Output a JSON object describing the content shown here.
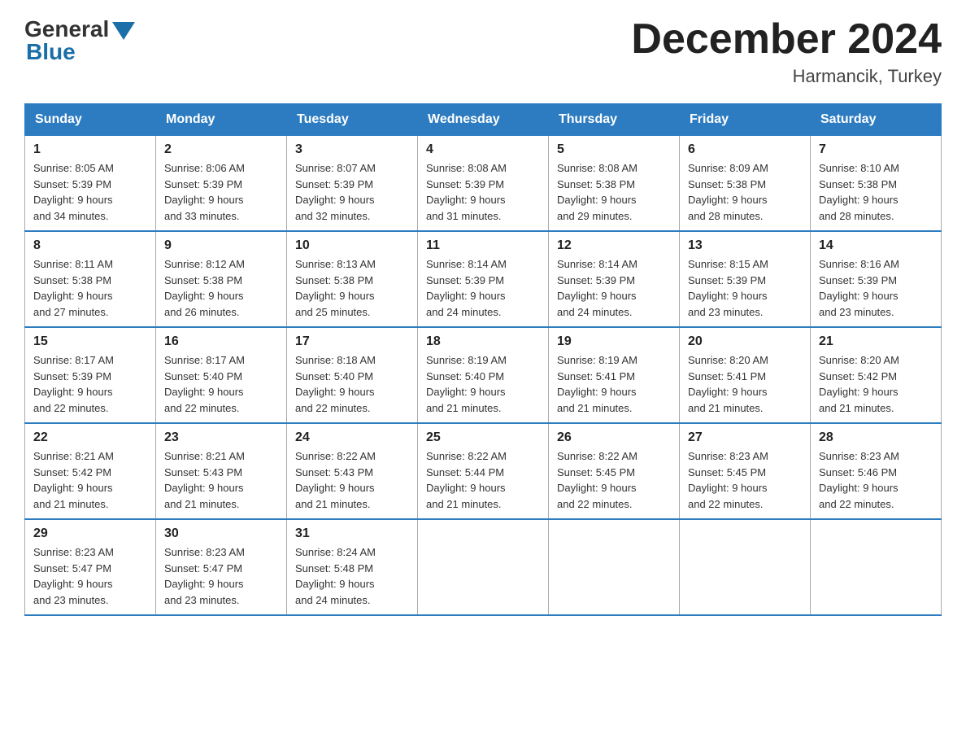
{
  "logo": {
    "general": "General",
    "blue": "Blue"
  },
  "title": "December 2024",
  "location": "Harmancik, Turkey",
  "days_of_week": [
    "Sunday",
    "Monday",
    "Tuesday",
    "Wednesday",
    "Thursday",
    "Friday",
    "Saturday"
  ],
  "weeks": [
    [
      {
        "day": "1",
        "sunrise": "8:05 AM",
        "sunset": "5:39 PM",
        "daylight": "9 hours and 34 minutes."
      },
      {
        "day": "2",
        "sunrise": "8:06 AM",
        "sunset": "5:39 PM",
        "daylight": "9 hours and 33 minutes."
      },
      {
        "day": "3",
        "sunrise": "8:07 AM",
        "sunset": "5:39 PM",
        "daylight": "9 hours and 32 minutes."
      },
      {
        "day": "4",
        "sunrise": "8:08 AM",
        "sunset": "5:39 PM",
        "daylight": "9 hours and 31 minutes."
      },
      {
        "day": "5",
        "sunrise": "8:08 AM",
        "sunset": "5:38 PM",
        "daylight": "9 hours and 29 minutes."
      },
      {
        "day": "6",
        "sunrise": "8:09 AM",
        "sunset": "5:38 PM",
        "daylight": "9 hours and 28 minutes."
      },
      {
        "day": "7",
        "sunrise": "8:10 AM",
        "sunset": "5:38 PM",
        "daylight": "9 hours and 28 minutes."
      }
    ],
    [
      {
        "day": "8",
        "sunrise": "8:11 AM",
        "sunset": "5:38 PM",
        "daylight": "9 hours and 27 minutes."
      },
      {
        "day": "9",
        "sunrise": "8:12 AM",
        "sunset": "5:38 PM",
        "daylight": "9 hours and 26 minutes."
      },
      {
        "day": "10",
        "sunrise": "8:13 AM",
        "sunset": "5:38 PM",
        "daylight": "9 hours and 25 minutes."
      },
      {
        "day": "11",
        "sunrise": "8:14 AM",
        "sunset": "5:39 PM",
        "daylight": "9 hours and 24 minutes."
      },
      {
        "day": "12",
        "sunrise": "8:14 AM",
        "sunset": "5:39 PM",
        "daylight": "9 hours and 24 minutes."
      },
      {
        "day": "13",
        "sunrise": "8:15 AM",
        "sunset": "5:39 PM",
        "daylight": "9 hours and 23 minutes."
      },
      {
        "day": "14",
        "sunrise": "8:16 AM",
        "sunset": "5:39 PM",
        "daylight": "9 hours and 23 minutes."
      }
    ],
    [
      {
        "day": "15",
        "sunrise": "8:17 AM",
        "sunset": "5:39 PM",
        "daylight": "9 hours and 22 minutes."
      },
      {
        "day": "16",
        "sunrise": "8:17 AM",
        "sunset": "5:40 PM",
        "daylight": "9 hours and 22 minutes."
      },
      {
        "day": "17",
        "sunrise": "8:18 AM",
        "sunset": "5:40 PM",
        "daylight": "9 hours and 22 minutes."
      },
      {
        "day": "18",
        "sunrise": "8:19 AM",
        "sunset": "5:40 PM",
        "daylight": "9 hours and 21 minutes."
      },
      {
        "day": "19",
        "sunrise": "8:19 AM",
        "sunset": "5:41 PM",
        "daylight": "9 hours and 21 minutes."
      },
      {
        "day": "20",
        "sunrise": "8:20 AM",
        "sunset": "5:41 PM",
        "daylight": "9 hours and 21 minutes."
      },
      {
        "day": "21",
        "sunrise": "8:20 AM",
        "sunset": "5:42 PM",
        "daylight": "9 hours and 21 minutes."
      }
    ],
    [
      {
        "day": "22",
        "sunrise": "8:21 AM",
        "sunset": "5:42 PM",
        "daylight": "9 hours and 21 minutes."
      },
      {
        "day": "23",
        "sunrise": "8:21 AM",
        "sunset": "5:43 PM",
        "daylight": "9 hours and 21 minutes."
      },
      {
        "day": "24",
        "sunrise": "8:22 AM",
        "sunset": "5:43 PM",
        "daylight": "9 hours and 21 minutes."
      },
      {
        "day": "25",
        "sunrise": "8:22 AM",
        "sunset": "5:44 PM",
        "daylight": "9 hours and 21 minutes."
      },
      {
        "day": "26",
        "sunrise": "8:22 AM",
        "sunset": "5:45 PM",
        "daylight": "9 hours and 22 minutes."
      },
      {
        "day": "27",
        "sunrise": "8:23 AM",
        "sunset": "5:45 PM",
        "daylight": "9 hours and 22 minutes."
      },
      {
        "day": "28",
        "sunrise": "8:23 AM",
        "sunset": "5:46 PM",
        "daylight": "9 hours and 22 minutes."
      }
    ],
    [
      {
        "day": "29",
        "sunrise": "8:23 AM",
        "sunset": "5:47 PM",
        "daylight": "9 hours and 23 minutes."
      },
      {
        "day": "30",
        "sunrise": "8:23 AM",
        "sunset": "5:47 PM",
        "daylight": "9 hours and 23 minutes."
      },
      {
        "day": "31",
        "sunrise": "8:24 AM",
        "sunset": "5:48 PM",
        "daylight": "9 hours and 24 minutes."
      },
      null,
      null,
      null,
      null
    ]
  ],
  "labels": {
    "sunrise": "Sunrise:",
    "sunset": "Sunset:",
    "daylight": "Daylight:"
  }
}
